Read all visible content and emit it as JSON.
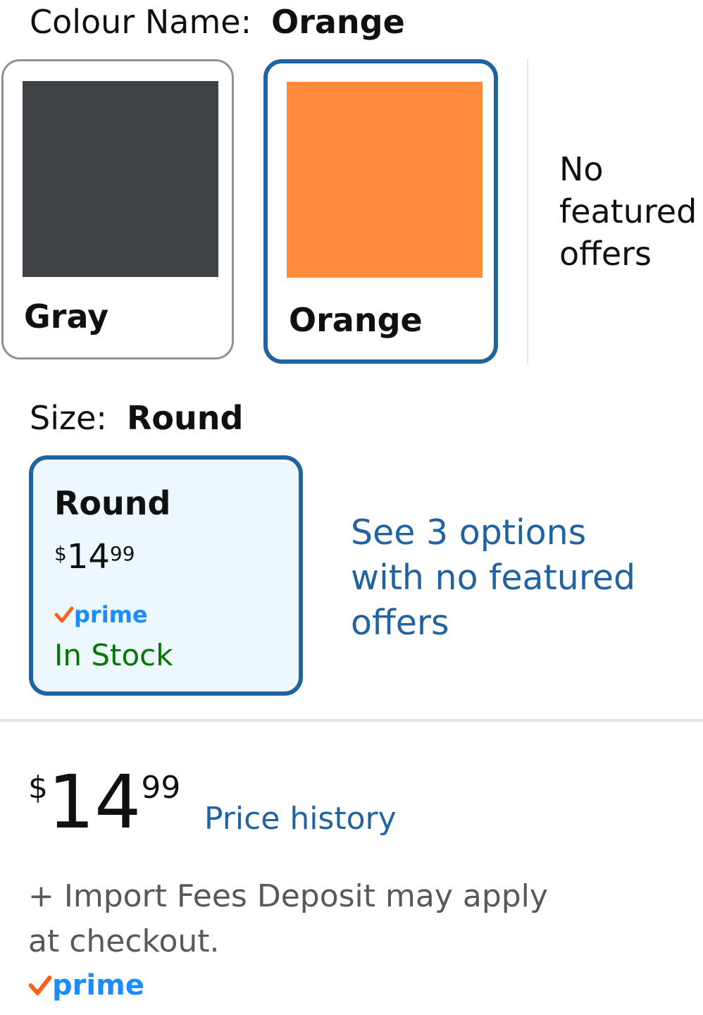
{
  "colour": {
    "label": "Colour Name:",
    "selected": "Orange",
    "options": [
      {
        "name": "Gray",
        "swatch_color": "#404345",
        "selected": false
      },
      {
        "name": "Orange",
        "swatch_color": "#fe8a3c",
        "selected": true
      }
    ],
    "no_featured": "No featured offers"
  },
  "size": {
    "label": "Size:",
    "selected": "Round",
    "card": {
      "title": "Round",
      "price_symbol": "$",
      "price_whole": "14",
      "price_fraction": "99",
      "prime": "prime",
      "stock": "In Stock"
    },
    "see_options": "See 3 options with no featured offers"
  },
  "price": {
    "symbol": "$",
    "whole": "14",
    "fraction": "99",
    "history_link": "Price history",
    "import_fees": "+ Import Fees Deposit may apply at checkout.",
    "prime": "prime"
  },
  "colors": {
    "link_blue": "#2162a1",
    "selected_border": "#2162a1",
    "in_stock_green": "#007600",
    "prime_blue": "#1a8cff",
    "prime_check_orange": "#f7631b"
  }
}
